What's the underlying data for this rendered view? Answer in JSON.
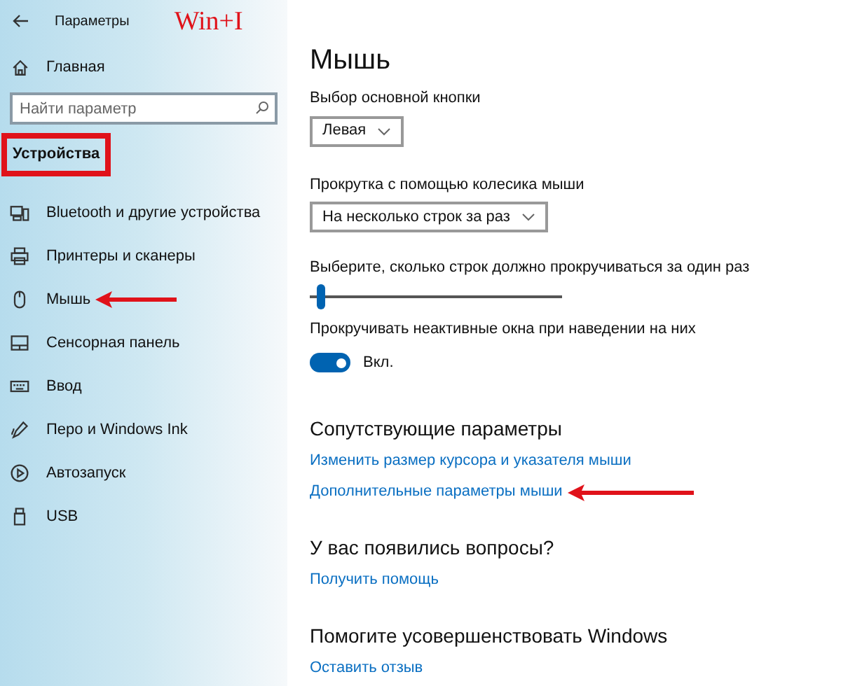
{
  "window": {
    "title": "Параметры"
  },
  "annotation": {
    "text": "Win+I"
  },
  "sidebar": {
    "home": "Главная",
    "search": {
      "placeholder": "Найти параметр"
    },
    "section": "Устройства",
    "items": [
      {
        "label": "Bluetooth и другие устройства",
        "kind": "bluetooth",
        "arrow": false
      },
      {
        "label": "Принтеры и сканеры",
        "kind": "printer",
        "arrow": false
      },
      {
        "label": "Мышь",
        "kind": "mouse",
        "arrow": true
      },
      {
        "label": "Сенсорная панель",
        "kind": "touchpad",
        "arrow": false
      },
      {
        "label": "Ввод",
        "kind": "keyboard",
        "arrow": false
      },
      {
        "label": "Перо и Windows Ink",
        "kind": "pen",
        "arrow": false
      },
      {
        "label": "Автозапуск",
        "kind": "autoplay",
        "arrow": false
      },
      {
        "label": "USB",
        "kind": "usb",
        "arrow": false
      }
    ]
  },
  "main": {
    "title": "Мышь",
    "primary_button": {
      "label": "Выбор основной кнопки",
      "value": "Левая"
    },
    "wheel": {
      "label": "Прокрутка с помощью колесика мыши",
      "value": "На несколько строк за раз"
    },
    "lines": {
      "label": "Выберите, сколько строк должно прокручиваться за один раз",
      "level": 0.03
    },
    "inactive_scroll": {
      "label": "Прокручивать неактивные окна при наведении на них",
      "on": true,
      "state": "Вкл."
    },
    "sections": [
      {
        "title": "Сопутствующие параметры",
        "links": [
          {
            "text": "Изменить размер курсора и указателя мыши",
            "arrow": false
          },
          {
            "text": "Дополнительные параметры мыши",
            "arrow": true
          }
        ]
      },
      {
        "title": "У вас появились вопросы?",
        "links": [
          {
            "text": "Получить помощь",
            "arrow": false
          }
        ]
      },
      {
        "title": "Помогите усовершенствовать Windows",
        "links": [
          {
            "text": "Оставить отзыв",
            "arrow": false
          }
        ]
      }
    ]
  }
}
